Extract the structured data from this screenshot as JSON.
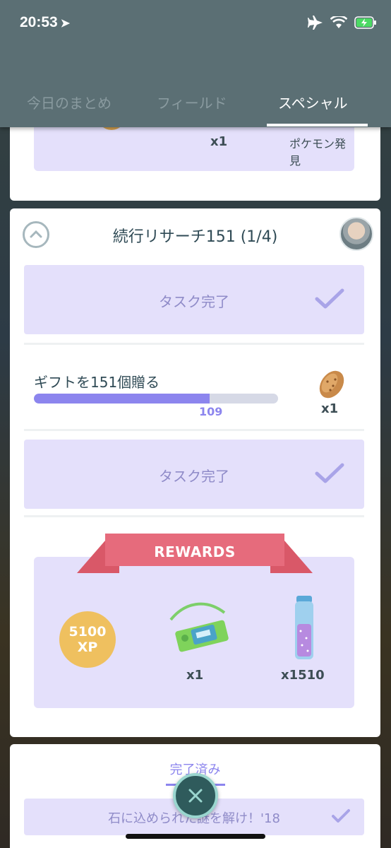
{
  "status_bar": {
    "time": "20:53"
  },
  "tabs": [
    {
      "label": "今日のまとめ"
    },
    {
      "label": "フィールド"
    },
    {
      "label": "スペシャル"
    }
  ],
  "previous_card": {
    "reward_qty": "x1",
    "reward_label": "ポケモン発見"
  },
  "research": {
    "title": "続行リサーチ151 (1/4)",
    "tasks": [
      {
        "label": "タスク完了"
      },
      {
        "label": "ギフトを151個贈る",
        "progress_value": "109",
        "progress_fraction": 0.72,
        "reward_qty": "x1"
      },
      {
        "label": "タスク完了"
      }
    ],
    "rewards_label": "REWARDS",
    "rewards": [
      {
        "xp_value": "5100",
        "xp_unit": "XP"
      },
      {
        "qty": "x1"
      },
      {
        "qty": "x1510"
      }
    ]
  },
  "completed": {
    "section_label": "完了済み",
    "task_label": "石に込められた謎を解け！'18"
  },
  "colors": {
    "accent": "#8c85ee",
    "task_bg": "#e4e0fb",
    "ribbon": "#e66b7c",
    "header": "#5b6f74"
  }
}
